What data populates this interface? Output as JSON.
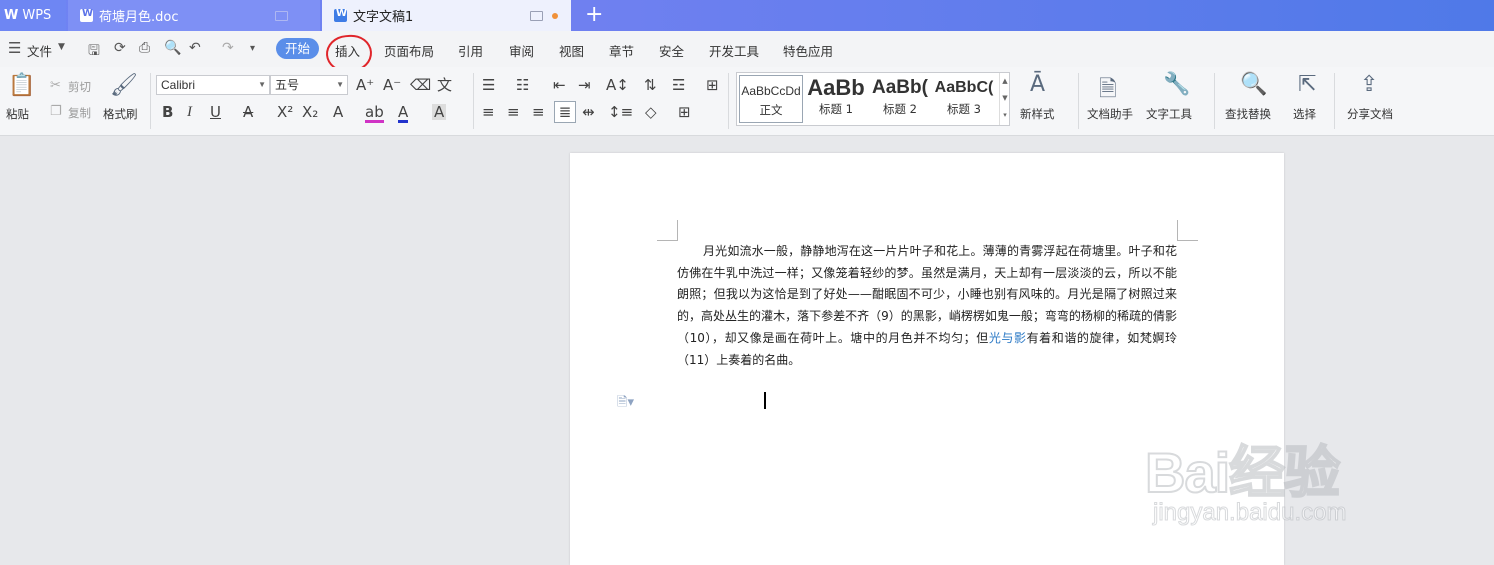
{
  "tabs": [
    {
      "label": "WPS"
    },
    {
      "label": "荷塘月色.doc"
    },
    {
      "label": "文字文稿1"
    }
  ],
  "menubar": {
    "file_label": "文件",
    "tabs": [
      "开始",
      "插入",
      "页面布局",
      "引用",
      "审阅",
      "视图",
      "章节",
      "安全",
      "开发工具",
      "特色应用"
    ]
  },
  "ribbon": {
    "paste": "粘贴",
    "cut": "剪切",
    "copy": "复制",
    "format_painter": "格式刷",
    "font_name": "Calibri",
    "font_size": "五号",
    "styles": [
      {
        "sample": "AaBbCcDd",
        "name": "正文"
      },
      {
        "sample": "AaBb",
        "name": "标题 1"
      },
      {
        "sample": "AaBb(",
        "name": "标题 2"
      },
      {
        "sample": "AaBbC(",
        "name": "标题 3"
      }
    ],
    "new_style": "新样式",
    "doc_assistant": "文档助手",
    "text_tools": "文字工具",
    "find_replace": "查找替换",
    "select": "选择",
    "share_doc": "分享文档"
  },
  "document": {
    "para_before": "月光如流水一般，静静地泻在这一片片叶子和花上。薄薄的青雾浮起在荷塘里。叶子和花仿佛在牛乳中洗过一样；又像笼着轻纱的梦。虽然是满月，天上却有一层淡淡的云，所以不能朗照；但我以为这恰是到了好处——酣眠固不可少，小睡也别有风味的。月光是隔了树照过来的，高处丛生的灌木，落下参差不齐（9）的黑影，峭楞楞如鬼一般；弯弯的杨柳的稀疏的倩影（10），却又像是画在荷叶上。塘中的月色并不均匀；但",
    "para_link": "光与影",
    "para_after": "有着和谐的旋律，如梵婀玲（11）上奏着的名曲。"
  },
  "watermark": {
    "brand": "Bai经验",
    "url": "jingyan.baidu.com"
  },
  "colors": {
    "titlebar": "#6f83f3",
    "active_tab_pill": "#5a8ee9",
    "annotation_circle": "#e0252a"
  }
}
